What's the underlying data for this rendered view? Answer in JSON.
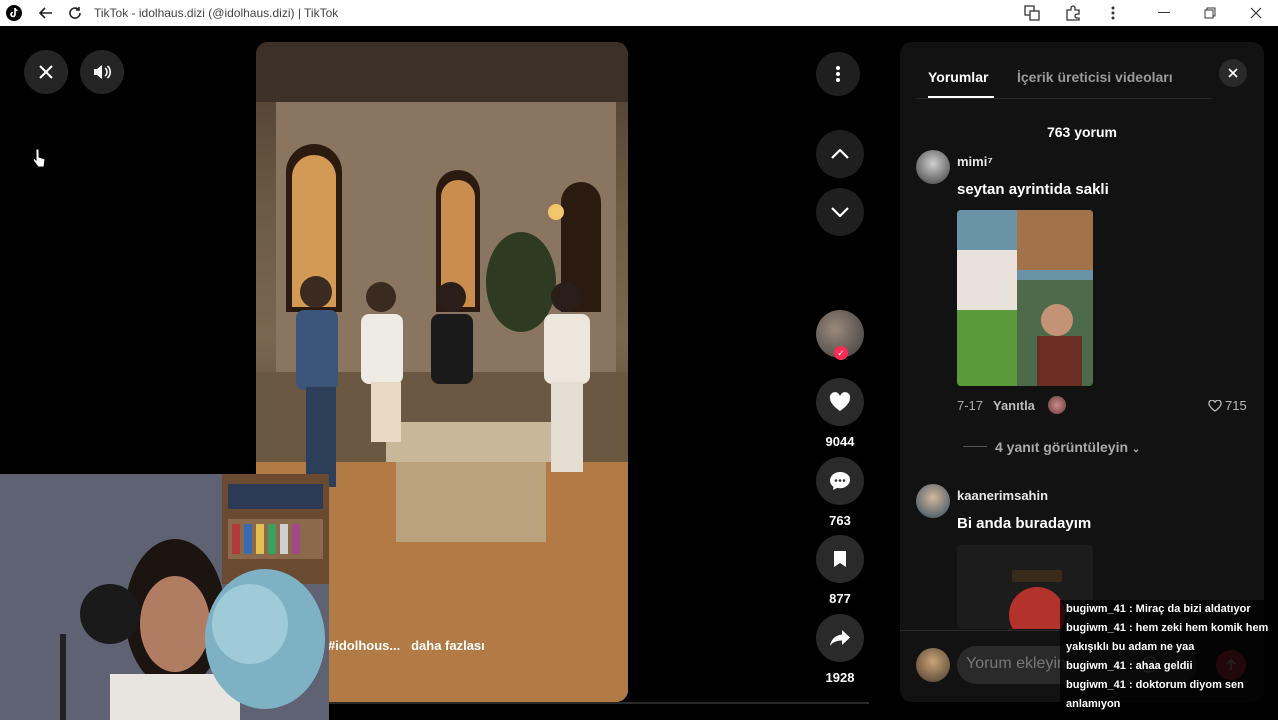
{
  "window": {
    "title": "TikTok - idolhaus.dizi (@idolhaus.dizi) | TikTok"
  },
  "video": {
    "caption_tag": "#idolhous...",
    "caption_more": "daha fazlası"
  },
  "actions": {
    "likes": "9044",
    "comments": "763",
    "saves": "877",
    "shares": "1928"
  },
  "panel": {
    "tabs": [
      "Yorumlar",
      "İçerik üreticisi videoları"
    ],
    "comment_count": "763 yorum",
    "comments": [
      {
        "user": "mimi⁷",
        "text": "seytan ayrintida sakli",
        "date": "7-17",
        "reply_label": "Yanıtla",
        "likes": "715",
        "view_replies": "4 yanıt görüntüleyin"
      },
      {
        "user": "kaanerimsahin",
        "text": "Bi anda buradayım"
      }
    ],
    "input_placeholder": "Yorum ekleyin..."
  },
  "chat": [
    "bugiwm_41 : Miraç da bizi aldatıyor",
    "bugiwm_41 : hem zeki hem komik hem yakışıklı bu adam ne yaa",
    "bugiwm_41 : ahaa geldii",
    "bugiwm_41 : doktorum diyom sen anlamıyon"
  ],
  "colors": {
    "panel_bg": "#121212",
    "accent": "#fe2c55"
  }
}
